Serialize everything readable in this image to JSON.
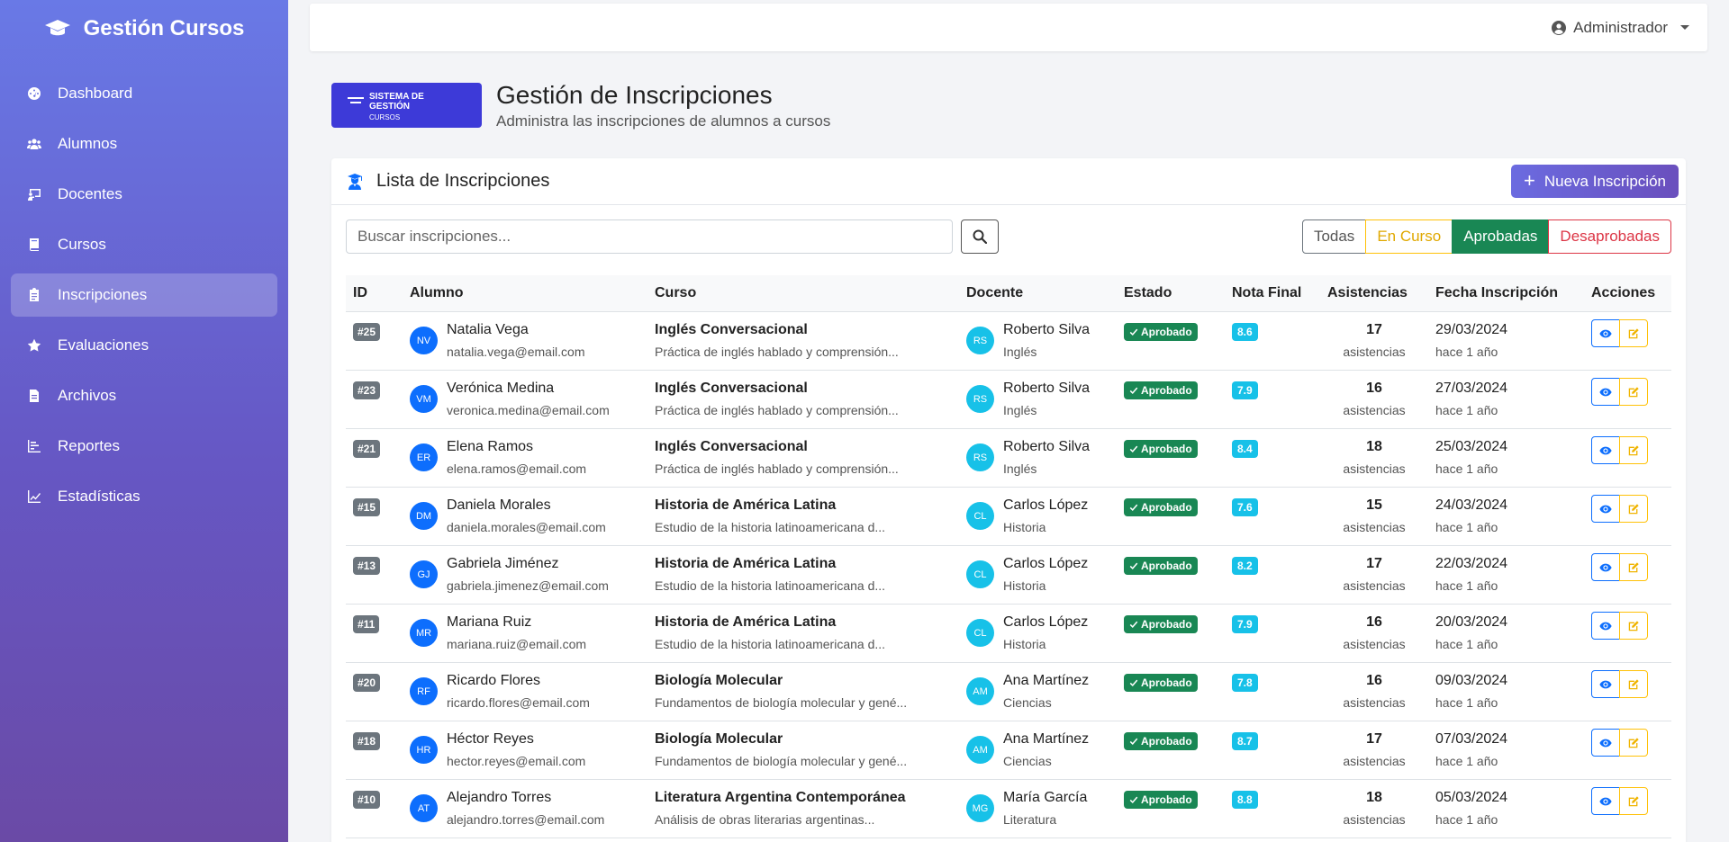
{
  "sidebar": {
    "brand": "Gestión Cursos",
    "items": [
      {
        "label": "Dashboard",
        "icon": "dashboard-icon"
      },
      {
        "label": "Alumnos",
        "icon": "users-icon"
      },
      {
        "label": "Docentes",
        "icon": "teacher-icon"
      },
      {
        "label": "Cursos",
        "icon": "book-icon"
      },
      {
        "label": "Inscripciones",
        "icon": "clipboard-icon",
        "active": true
      },
      {
        "label": "Evaluaciones",
        "icon": "star-icon"
      },
      {
        "label": "Archivos",
        "icon": "file-icon"
      },
      {
        "label": "Reportes",
        "icon": "bar-chart-icon"
      },
      {
        "label": "Estadísticas",
        "icon": "line-chart-icon"
      }
    ]
  },
  "topbar": {
    "user": "Administrador"
  },
  "header": {
    "logo_line1": "SISTEMA DE",
    "logo_line2": "GESTIÓN",
    "logo_line3": "CURSOS",
    "title": "Gestión de Inscripciones",
    "subtitle": "Administra las inscripciones de alumnos a cursos"
  },
  "card": {
    "title": "Lista de Inscripciones",
    "new_button": "Nueva Inscripción",
    "search_placeholder": "Buscar inscripciones...",
    "filters": [
      "Todas",
      "En Curso",
      "Aprobadas",
      "Desaprobadas"
    ],
    "active_filter": "Aprobadas"
  },
  "table": {
    "headers": [
      "ID",
      "Alumno",
      "Curso",
      "Docente",
      "Estado",
      "Nota Final",
      "Asistencias",
      "Fecha Inscripción",
      "Acciones"
    ],
    "attendance_label": "asistencias",
    "rows": [
      {
        "id": "#25",
        "initials": "NV",
        "name": "Natalia Vega",
        "email": "natalia.vega@email.com",
        "course": "Inglés Conversacional",
        "course_desc": "Práctica de inglés hablado y comprensión...",
        "t_initials": "RS",
        "teacher": "Roberto Silva",
        "subject": "Inglés",
        "status": "Aprobado",
        "grade": "8.6",
        "attendance": "17",
        "date": "29/03/2024",
        "ago": "hace 1 año"
      },
      {
        "id": "#23",
        "initials": "VM",
        "name": "Verónica Medina",
        "email": "veronica.medina@email.com",
        "course": "Inglés Conversacional",
        "course_desc": "Práctica de inglés hablado y comprensión...",
        "t_initials": "RS",
        "teacher": "Roberto Silva",
        "subject": "Inglés",
        "status": "Aprobado",
        "grade": "7.9",
        "attendance": "16",
        "date": "27/03/2024",
        "ago": "hace 1 año"
      },
      {
        "id": "#21",
        "initials": "ER",
        "name": "Elena Ramos",
        "email": "elena.ramos@email.com",
        "course": "Inglés Conversacional",
        "course_desc": "Práctica de inglés hablado y comprensión...",
        "t_initials": "RS",
        "teacher": "Roberto Silva",
        "subject": "Inglés",
        "status": "Aprobado",
        "grade": "8.4",
        "attendance": "18",
        "date": "25/03/2024",
        "ago": "hace 1 año"
      },
      {
        "id": "#15",
        "initials": "DM",
        "name": "Daniela Morales",
        "email": "daniela.morales@email.com",
        "course": "Historia de América Latina",
        "course_desc": "Estudio de la historia latinoamericana d...",
        "t_initials": "CL",
        "teacher": "Carlos López",
        "subject": "Historia",
        "status": "Aprobado",
        "grade": "7.6",
        "attendance": "15",
        "date": "24/03/2024",
        "ago": "hace 1 año"
      },
      {
        "id": "#13",
        "initials": "GJ",
        "name": "Gabriela Jiménez",
        "email": "gabriela.jimenez@email.com",
        "course": "Historia de América Latina",
        "course_desc": "Estudio de la historia latinoamericana d...",
        "t_initials": "CL",
        "teacher": "Carlos López",
        "subject": "Historia",
        "status": "Aprobado",
        "grade": "8.2",
        "attendance": "17",
        "date": "22/03/2024",
        "ago": "hace 1 año"
      },
      {
        "id": "#11",
        "initials": "MR",
        "name": "Mariana Ruiz",
        "email": "mariana.ruiz@email.com",
        "course": "Historia de América Latina",
        "course_desc": "Estudio de la historia latinoamericana d...",
        "t_initials": "CL",
        "teacher": "Carlos López",
        "subject": "Historia",
        "status": "Aprobado",
        "grade": "7.9",
        "attendance": "16",
        "date": "20/03/2024",
        "ago": "hace 1 año"
      },
      {
        "id": "#20",
        "initials": "RF",
        "name": "Ricardo Flores",
        "email": "ricardo.flores@email.com",
        "course": "Biología Molecular",
        "course_desc": "Fundamentos de biología molecular y gené...",
        "t_initials": "AM",
        "teacher": "Ana Martínez",
        "subject": "Ciencias",
        "status": "Aprobado",
        "grade": "7.8",
        "attendance": "16",
        "date": "09/03/2024",
        "ago": "hace 1 año"
      },
      {
        "id": "#18",
        "initials": "HR",
        "name": "Héctor Reyes",
        "email": "hector.reyes@email.com",
        "course": "Biología Molecular",
        "course_desc": "Fundamentos de biología molecular y gené...",
        "t_initials": "AM",
        "teacher": "Ana Martínez",
        "subject": "Ciencias",
        "status": "Aprobado",
        "grade": "8.7",
        "attendance": "17",
        "date": "07/03/2024",
        "ago": "hace 1 año"
      },
      {
        "id": "#10",
        "initials": "AT",
        "name": "Alejandro Torres",
        "email": "alejandro.torres@email.com",
        "course": "Literatura Argentina Contemporánea",
        "course_desc": "Análisis de obras literarias argentinas...",
        "t_initials": "MG",
        "teacher": "María García",
        "subject": "Literatura",
        "status": "Aprobado",
        "grade": "8.8",
        "attendance": "18",
        "date": "05/03/2024",
        "ago": "hace 1 año"
      }
    ]
  },
  "colors": {
    "sidebar_top": "#6979e6",
    "sidebar_bottom": "#6a4aa6",
    "status_approved": "#198754",
    "grade_badge": "#17c1e8",
    "primary": "#0d6efd"
  }
}
